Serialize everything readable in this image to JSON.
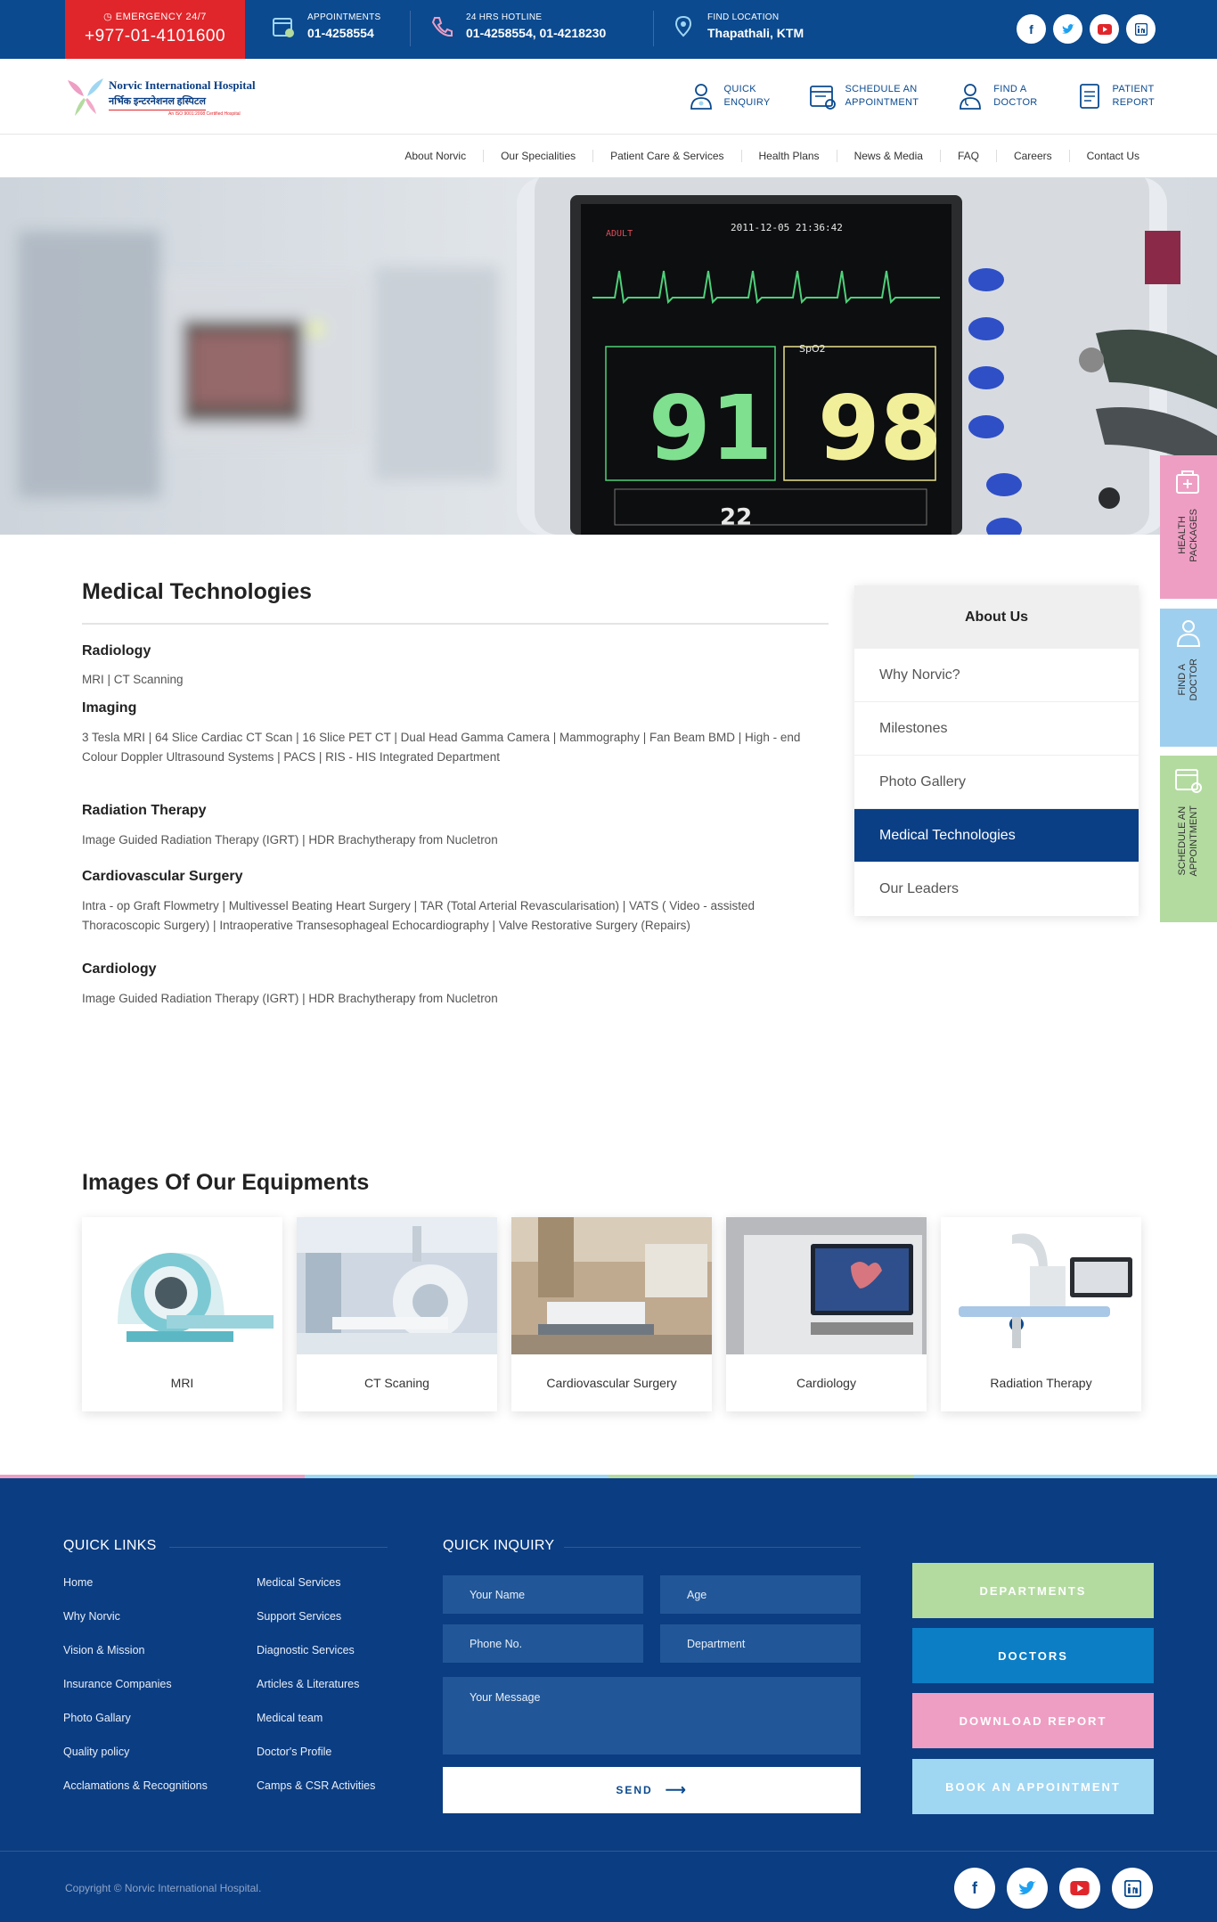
{
  "topbar": {
    "emergency_label": "EMERGENCY 24/7",
    "emergency_number": "+977-01-4101600",
    "appointments_label": "APPOINTMENTS",
    "appointments_number": "01-4258554",
    "hotline_label": "24 HRS HOTLINE",
    "hotline_number": "01-4258554, 01-4218230",
    "location_label": "FIND LOCATION",
    "location_value": "Thapathali, KTM",
    "social_icons": [
      "facebook-icon",
      "twitter-icon",
      "youtube-icon",
      "linkedin-icon"
    ]
  },
  "header": {
    "logo_name": "Norvic International Hospital",
    "logo_nepali": "नर्भिक इन्टरनेशनल हस्पिटल",
    "logo_tagline": "An ISO 9001:2008 Certified Hospital",
    "links": [
      {
        "line1": "QUICK",
        "line2": "ENQUIRY",
        "icon": "person-icon"
      },
      {
        "line1": "SCHEDULE AN",
        "line2": "APPOINTMENT",
        "icon": "calendar-icon"
      },
      {
        "line1": "FIND A",
        "line2": "DOCTOR",
        "icon": "doctor-icon"
      },
      {
        "line1": "PATIENT",
        "line2": "REPORT",
        "icon": "report-icon"
      }
    ]
  },
  "nav": [
    "About Norvic",
    "Our Specialities",
    "Patient Care & Services",
    "Health Plans",
    "News & Media",
    "FAQ",
    "Careers",
    "Contact Us"
  ],
  "hero": {
    "monitor_time": "2011-12-05  21:36:42",
    "monitor_mode": "ADULT",
    "hr_value": "91",
    "spo2_value": "98",
    "spo2_label": "SpO2",
    "small_value": "22"
  },
  "main": {
    "title": "Medical Technologies",
    "sections": [
      {
        "heading": "Radiology",
        "text": "MRI  |  CT Scanning"
      },
      {
        "heading": "Imaging",
        "text": "3 Tesla MRI  |  64 Slice Cardiac CT Scan  |  16 Slice PET CT  |  Dual Head Gamma Camera  |  Mammography  |  Fan Beam BMD  |  High - end Colour Doppler Ultrasound Systems  |  PACS  |  RIS - HIS Integrated Department"
      },
      {
        "heading": "Radiation Therapy",
        "text": "Image Guided Radiation Therapy (IGRT)  |  HDR Brachytherapy from Nucletron"
      },
      {
        "heading": "Cardiovascular Surgery",
        "text": "Intra - op Graft Flowmetry  |  Multivessel Beating Heart Surgery  |  TAR (Total Arterial Revascularisation)  |  VATS ( Video - assisted Thoracoscopic Surgery)  |  Intraoperative Transesophageal Echocardiography  |  Valve Restorative Surgery (Repairs)"
      },
      {
        "heading": "Cardiology",
        "text": "Image Guided Radiation Therapy (IGRT)  |  HDR Brachytherapy from Nucletron"
      }
    ]
  },
  "sidebar": {
    "heading": "About Us",
    "items": [
      "Why Norvic?",
      "Milestones",
      "Photo Gallery",
      "Medical Technologies",
      "Our Leaders"
    ],
    "active": "Medical Technologies"
  },
  "right_tabs": [
    {
      "line1": "HEALTH",
      "line2": "PACKAGES",
      "color": "#ee9ec3"
    },
    {
      "line1": "FIND A",
      "line2": "DOCTOR",
      "color": "#9fcfee"
    },
    {
      "line1": "SCHEDULE AN",
      "line2": "APPOINTMENT",
      "color": "#b3dba0"
    }
  ],
  "equipment": {
    "title": "Images Of Our Equipments",
    "items": [
      "MRI",
      "CT Scaning",
      "Cardiovascular Surgery",
      "Cardiology",
      "Radiation Therapy"
    ]
  },
  "footer": {
    "quick_links_title": "QUICK LINKS",
    "links_col1": [
      "Home",
      "Why Norvic",
      "Vision & Mission",
      "Insurance Companies",
      "Photo Gallary",
      "Quality policy",
      "Acclamations & Recognitions"
    ],
    "links_col2": [
      "Medical Services",
      "Support Services",
      "Diagnostic Services",
      "Articles & Literatures",
      "Medical team",
      "Doctor's Profile",
      "Camps & CSR Activities"
    ],
    "inquiry_title": "QUICK INQUIRY",
    "name_placeholder": "Your Name",
    "age_placeholder": "Age",
    "phone_placeholder": "Phone No.",
    "department_placeholder": "Department",
    "message_placeholder": "Your Message",
    "send_label": "SEND",
    "buttons": [
      {
        "label": "DEPARTMENTS",
        "color": "#b3dba0"
      },
      {
        "label": "DOCTORS",
        "color": "#0c7ec5"
      },
      {
        "label": "DOWNLOAD REPORT",
        "color": "#ee9ec3"
      },
      {
        "label": "BOOK AN APPOINTMENT",
        "color": "#9fd6f2"
      }
    ],
    "copyright": "Copyright © Norvic International Hospital."
  },
  "colors": {
    "primary": "#0b4a8f",
    "emergency": "#e0262b",
    "footer_bg": "#0b3d82",
    "active_item": "#0b3f85"
  }
}
